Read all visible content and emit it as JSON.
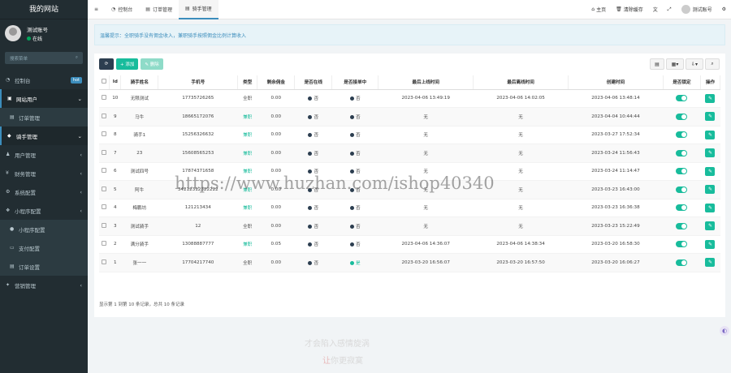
{
  "app": {
    "title": "我的网站"
  },
  "user": {
    "name": "测试账号",
    "status": "在线"
  },
  "sidebar": {
    "search_placeholder": "搜索菜单",
    "items": [
      {
        "label": "控制台",
        "icon": "dashboard-icon",
        "badge": "hot"
      },
      {
        "label": "网站用户",
        "icon": "users-icon",
        "active": true
      },
      {
        "label": "订单管理",
        "icon": "list-icon",
        "sub": true
      },
      {
        "label": "骑手管理",
        "icon": "rider-icon",
        "active": true
      },
      {
        "label": "用户管理",
        "icon": "user-icon"
      },
      {
        "label": "财务管理",
        "icon": "money-icon"
      },
      {
        "label": "系统配置",
        "icon": "gear-icon"
      },
      {
        "label": "小程序配置",
        "icon": "app-icon"
      },
      {
        "label": "小程序配置",
        "icon": "circle-icon",
        "sub": true
      },
      {
        "label": "支付配置",
        "icon": "pay-icon",
        "sub": true
      },
      {
        "label": "订单设置",
        "icon": "list-icon",
        "sub": true
      },
      {
        "label": "营销管理",
        "icon": "market-icon"
      }
    ]
  },
  "topbar": {
    "menu_icon": "≡",
    "tabs": [
      {
        "label": "控制台",
        "icon": "dashboard-icon"
      },
      {
        "label": "订单管理",
        "icon": "list-icon"
      },
      {
        "label": "骑手管理",
        "icon": "list-icon",
        "active": true
      }
    ],
    "right": {
      "home": "主页",
      "clear": "清除缓存",
      "account": "测试账号"
    }
  },
  "alert": {
    "text": "温馨提示：全职骑手没有佣金收入，兼职骑手按照佣金比例计算收入"
  },
  "toolbar": {
    "add": "+ 添加",
    "delete": "✎ 删除"
  },
  "table": {
    "columns": [
      "",
      "Id",
      "骑手姓名",
      "手机号",
      "类型",
      "剩余佣金",
      "是否在线",
      "是否接单中",
      "最后上线时间",
      "最后离线时间",
      "创建时间",
      "是否锁定",
      "操作"
    ],
    "rows": [
      {
        "id": "10",
        "name": "无限测试",
        "phone": "17735726265",
        "type": "全职",
        "commission": "0.00",
        "online": "否",
        "taking": "否",
        "last_online": "2023-04-06 13:49:19",
        "last_offline": "2023-04-06 14:02:05",
        "created": "2023-04-06 13:48:14"
      },
      {
        "id": "9",
        "name": "马牛",
        "phone": "18665172076",
        "type": "兼职",
        "commission": "0.00",
        "online": "否",
        "taking": "否",
        "last_online": "无",
        "last_offline": "无",
        "created": "2023-04-04 10:44:44"
      },
      {
        "id": "8",
        "name": "骑手1",
        "phone": "15256326632",
        "type": "兼职",
        "commission": "0.00",
        "online": "否",
        "taking": "否",
        "last_online": "无",
        "last_offline": "无",
        "created": "2023-03-27 17:52:34"
      },
      {
        "id": "7",
        "name": "23",
        "phone": "15608565253",
        "type": "兼职",
        "commission": "0.00",
        "online": "否",
        "taking": "否",
        "last_online": "无",
        "last_offline": "无",
        "created": "2023-03-24 11:56:43"
      },
      {
        "id": "6",
        "name": "测试四号",
        "phone": "17874371658",
        "type": "兼职",
        "commission": "0.00",
        "online": "否",
        "taking": "否",
        "last_online": "无",
        "last_offline": "无",
        "created": "2023-03-24 11:14:47"
      },
      {
        "id": "5",
        "name": "阿牛",
        "phone": "34212312322222",
        "type": "兼职",
        "commission": "0.00",
        "online": "否",
        "taking": "否",
        "last_online": "无",
        "last_offline": "无",
        "created": "2023-03-23 16:43:00"
      },
      {
        "id": "4",
        "name": "梅鹏坊",
        "phone": "121213434",
        "type": "兼职",
        "commission": "0.00",
        "online": "否",
        "taking": "否",
        "last_online": "无",
        "last_offline": "无",
        "created": "2023-03-23 16:36:38"
      },
      {
        "id": "3",
        "name": "测试骑手",
        "phone": "12",
        "type": "全职",
        "commission": "0.00",
        "online": "否",
        "taking": "否",
        "last_online": "无",
        "last_offline": "无",
        "created": "2023-03-23 15:22:49"
      },
      {
        "id": "2",
        "name": "满分骑手",
        "phone": "13088887777",
        "type": "兼职",
        "commission": "0.05",
        "online": "否",
        "taking": "否",
        "last_online": "2023-04-06 14:36:07",
        "last_offline": "2023-04-06 14:38:34",
        "created": "2023-03-20 16:58:30"
      },
      {
        "id": "1",
        "name": "张一一",
        "phone": "17704217740",
        "type": "全职",
        "commission": "0.00",
        "online": "否",
        "taking": "是",
        "last_online": "2023-03-20 16:56:07",
        "last_offline": "2023-03-20 16:57:50",
        "created": "2023-03-20 16:06:27"
      }
    ]
  },
  "pagination": {
    "text": "显示第 1 到第 10 条记录，总共 10 条记录"
  },
  "watermark": {
    "url": "https://www.huzhan.com/ishop40340",
    "line1": "才会陷入感情旋涡",
    "line2a": "让",
    "line2b": "你更寂寞"
  },
  "colors": {
    "accent": "#18bc9c",
    "sidebar": "#222d32",
    "dot_no": "#2c3e50",
    "dot_yes": "#18bc9c"
  }
}
